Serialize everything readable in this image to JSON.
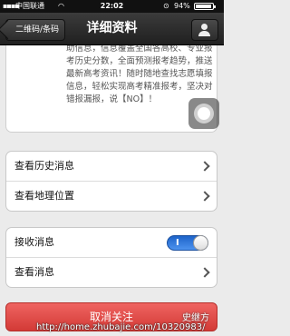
{
  "status_bar": {
    "carrier": "中国联通",
    "time": "22:02",
    "battery": "94%",
    "battery_level": 0.94,
    "icons": [
      "signal-icon",
      "wifi-icon",
      "lock-icon",
      "battery-icon"
    ]
  },
  "navbar": {
    "back_label": "二维码/条码",
    "title": "详细资料",
    "profile_icon": "person-icon"
  },
  "intro": {
    "text": "助信息，信息覆盖全国各高校、专业报考历史分数，全面预测报考趋势，推送最新高考资讯！随时随地查找志愿填报信息，轻松实现高考精准报考，坚决对错报漏报，说【NO】！"
  },
  "group1": {
    "history": "查看历史消息",
    "location": "查看地理位置"
  },
  "group2": {
    "receive": "接收消息",
    "receive_on": true,
    "toggle_glyph": "I",
    "view": "查看消息"
  },
  "unfollow_label": "取消关注",
  "watermark": {
    "name": "史继方",
    "url": "http://home.zhubajie.com/10320983/"
  },
  "colors": {
    "toggle_on": "#3a7fdd",
    "unfollow": "#e14c48",
    "navbar": "#2a2a2a"
  }
}
